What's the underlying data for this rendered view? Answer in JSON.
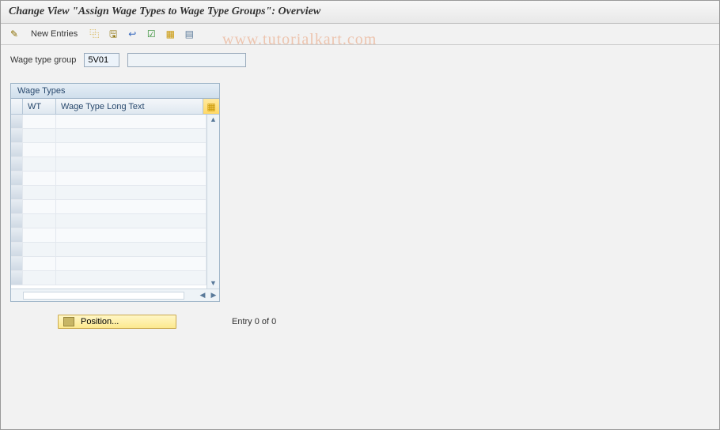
{
  "header": {
    "title": "Change View \"Assign Wage Types to Wage Type Groups\": Overview"
  },
  "toolbar": {
    "new_entries_label": "New Entries"
  },
  "fields": {
    "wage_type_group_label": "Wage type group",
    "wage_type_group_value": "5V01",
    "wage_type_group_desc": ""
  },
  "table": {
    "title": "Wage Types",
    "columns": {
      "wt": "WT",
      "long_text": "Wage Type Long Text"
    },
    "rows": [
      {
        "wt": "",
        "long_text": ""
      },
      {
        "wt": "",
        "long_text": ""
      },
      {
        "wt": "",
        "long_text": ""
      },
      {
        "wt": "",
        "long_text": ""
      },
      {
        "wt": "",
        "long_text": ""
      },
      {
        "wt": "",
        "long_text": ""
      },
      {
        "wt": "",
        "long_text": ""
      },
      {
        "wt": "",
        "long_text": ""
      },
      {
        "wt": "",
        "long_text": ""
      },
      {
        "wt": "",
        "long_text": ""
      },
      {
        "wt": "",
        "long_text": ""
      },
      {
        "wt": "",
        "long_text": ""
      }
    ]
  },
  "footer": {
    "position_label": "Position...",
    "entry_status": "Entry 0 of 0"
  },
  "watermark": "www.tutorialkart.com"
}
